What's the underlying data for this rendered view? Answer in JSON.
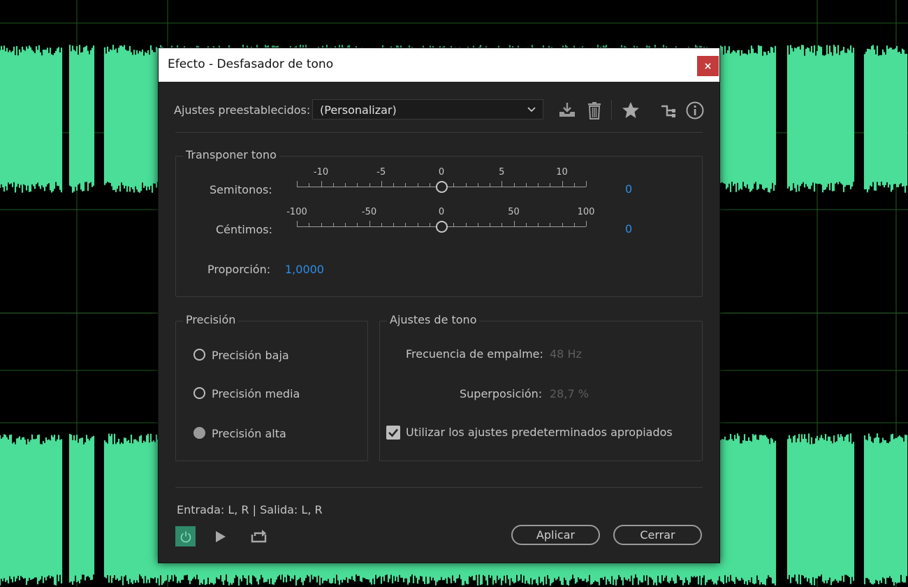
{
  "dialog": {
    "title": "Efecto - Desfasador de tono",
    "close_symbol": "×"
  },
  "presets": {
    "label": "Ajustes preestablecidos:",
    "selected": "(Personalizar)",
    "icons": [
      "download-preset-icon",
      "delete-preset-icon",
      "favorite-star-icon",
      "routing-icon",
      "info-icon"
    ]
  },
  "transpose": {
    "title": "Transponer tono",
    "semitones": {
      "label": "Semitonos:",
      "value": "0",
      "min": -12,
      "max": 12,
      "current": 0,
      "tick_labels": [
        "-10",
        "-5",
        "0",
        "5",
        "10"
      ]
    },
    "cents": {
      "label": "Céntimos:",
      "value": "0",
      "min": -100,
      "max": 100,
      "current": 0,
      "tick_labels": [
        "-100",
        "-50",
        "0",
        "50",
        "100"
      ]
    },
    "ratio": {
      "label": "Proporción:",
      "value": "1,0000"
    }
  },
  "precision": {
    "title": "Precisión",
    "options": [
      {
        "label": "Precisión baja",
        "selected": false
      },
      {
        "label": "Precisión media",
        "selected": false
      },
      {
        "label": "Precisión alta",
        "selected": true
      }
    ]
  },
  "pitch_settings": {
    "title": "Ajustes de tono",
    "splice": {
      "label": "Frecuencia de empalme:",
      "value": "48 Hz"
    },
    "overlap": {
      "label": "Superposición:",
      "value": "28,7 %"
    },
    "use_defaults": {
      "label": "Utilizar los ajustes predeterminados apropiados",
      "checked": true
    }
  },
  "footer": {
    "io": "Entrada: L, R | Salida: L, R",
    "apply": "Aplicar",
    "close": "Cerrar",
    "icons": [
      "power-icon",
      "play-icon",
      "loop-icon"
    ]
  },
  "colors": {
    "waveform": "#4ade98",
    "accent_blue": "#2e8de6",
    "power_green": "#2f8a6a",
    "close_red": "#c43b3b"
  }
}
